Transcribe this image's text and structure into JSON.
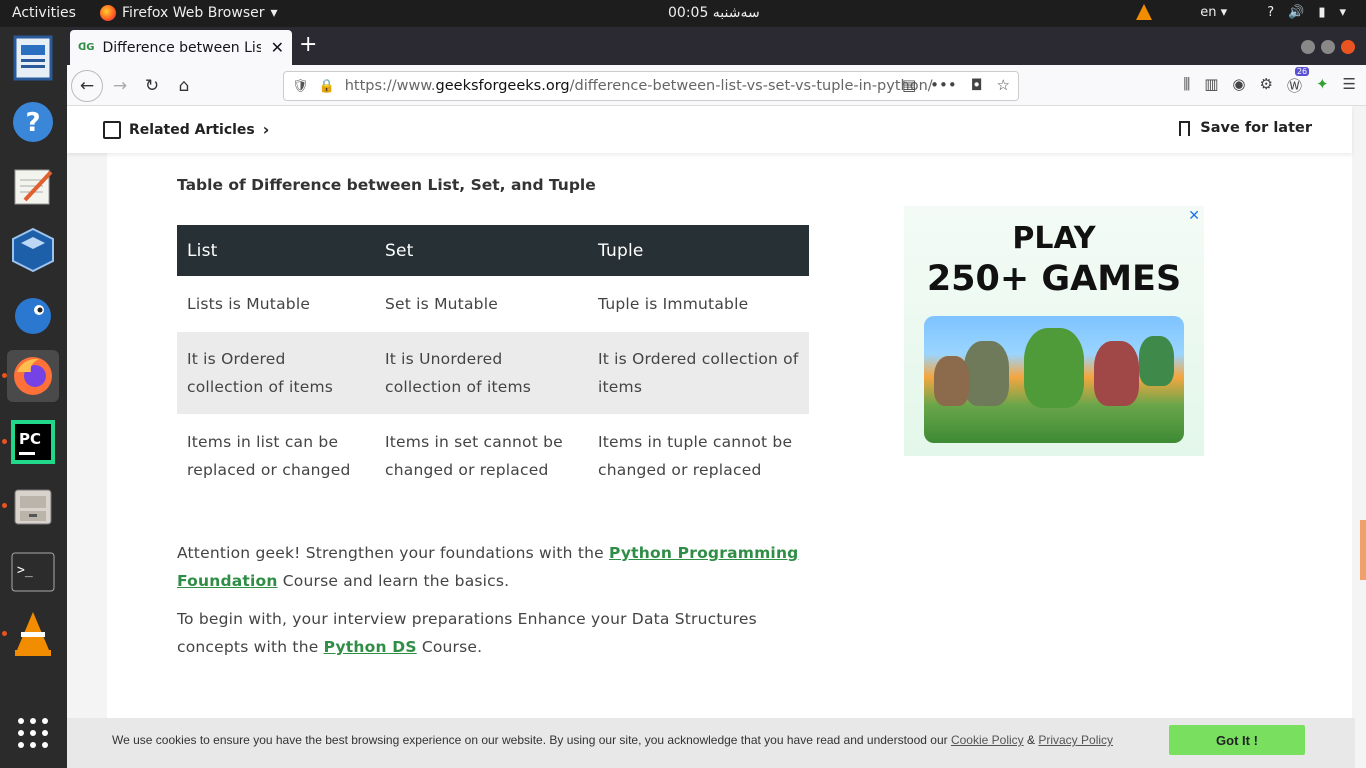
{
  "topbar": {
    "activities": "Activities",
    "app_menu": "Firefox Web Browser",
    "clock": "00:05 سەشنبە",
    "lang": "en",
    "help": "?"
  },
  "browser": {
    "tab_title": "Difference between List",
    "tab_favicon": "ꓷG",
    "new_tab": "+",
    "url_prefix": "https://www.",
    "url_domain": "geeksforgeeks.org",
    "url_path": "/difference-between-list-vs-set-vs-tuple-in-python/",
    "ext_badge": "26"
  },
  "article_bar": {
    "related": "Related Articles",
    "save": "Save for later"
  },
  "content": {
    "table_heading": "Table of Difference between List, Set, and Tuple",
    "table": {
      "headers": [
        "List",
        "Set",
        "Tuple"
      ],
      "rows": [
        [
          "Lists is Mutable",
          "Set is Mutable",
          "Tuple is Immutable"
        ],
        [
          "It is Ordered collection of items",
          "It is Unordered collection of items",
          "It is Ordered collection of items"
        ],
        [
          "Items in list can be replaced or changed",
          "Items in set cannot be changed or replaced",
          "Items in tuple cannot be changed or replaced"
        ]
      ]
    },
    "para1_a": "Attention geek! Strengthen your foundations with the ",
    "para1_link": "Python Programming Foundation",
    "para1_b": " Course and learn the basics.",
    "para2_a": "To begin with, your interview preparations Enhance your Data Structures concepts with the ",
    "para2_link": "Python DS",
    "para2_b": " Course."
  },
  "ad": {
    "line1": "PLAY",
    "line2": "250+ GAMES",
    "close": "✕"
  },
  "cookie": {
    "message": "We use cookies to ensure you have the best browsing experience on our website. By using our site, you acknowledge that you have read and understood our ",
    "cookie_policy": "Cookie Policy",
    "amp": " & ",
    "privacy_policy": "Privacy Policy",
    "button": "Got It !"
  },
  "colors": {
    "gfg_green": "#2f8d46",
    "table_header": "#273035",
    "accept_button": "#79e05f"
  }
}
